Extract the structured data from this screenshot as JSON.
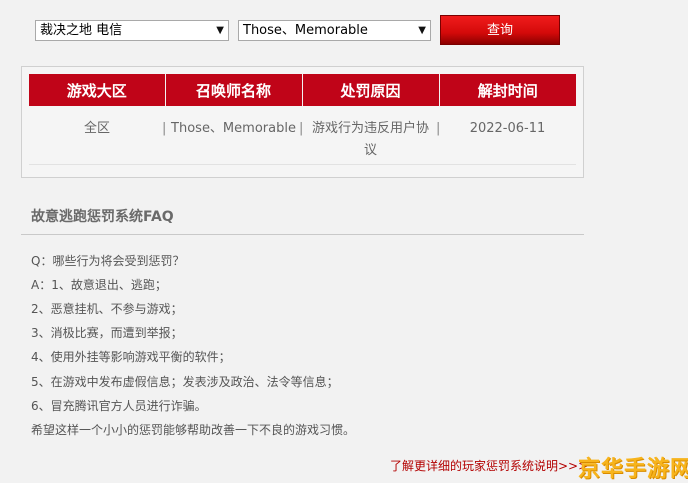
{
  "filters": {
    "region_value": "裁决之地 电信",
    "name_value": "Those、Memorable",
    "query_label": "查询"
  },
  "table": {
    "headers": [
      "游戏大区",
      "召唤师名称",
      "处罚原因",
      "解封时间"
    ],
    "rows": [
      [
        "全区",
        "Those、Memorable",
        "游戏行为违反用户协议",
        "2022-06-11"
      ]
    ]
  },
  "faq": {
    "title": "故意逃跑惩罚系统FAQ",
    "lines": [
      "Q：哪些行为将会受到惩罚？",
      "A：1、故意退出、逃跑；",
      "2、恶意挂机、不参与游戏；",
      "3、消极比赛，而遭到举报；",
      "4、使用外挂等影响游戏平衡的软件；",
      "5、在游戏中发布虚假信息；发表涉及政治、法令等信息；",
      "6、冒充腾讯官方人员进行诈骗。",
      "希望这样一个小小的惩罚能够帮助改善一下不良的游戏习惯。"
    ]
  },
  "more_link": "了解更详细的玩家惩罚系统说明>>>",
  "watermark": "京华手游网",
  "icons": {
    "select_arrow": "chevron-down-icon"
  },
  "colors": {
    "accent": "#c00418",
    "link": "#b30000",
    "watermark": "#f7b41c"
  }
}
